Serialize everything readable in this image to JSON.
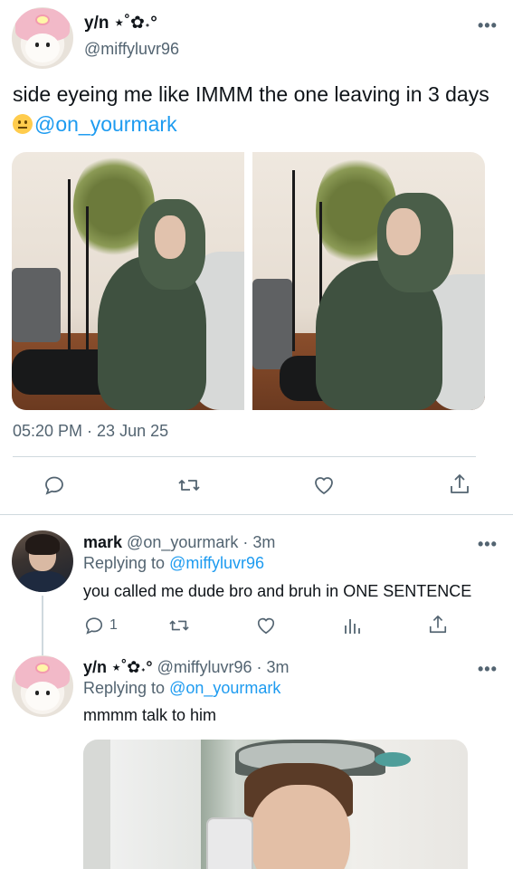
{
  "main_tweet": {
    "display_name": "y/n ⋆˚✿˖°",
    "handle": "@miffyluvr96",
    "more_label": "•••",
    "text": "side eyeing me like IMMM the one leaving in 3 days",
    "emoji": "neutral-face",
    "mention": "@on_yourmark",
    "timestamp": "05:20 PM · 23 Jun 25"
  },
  "actions": {
    "reply": "reply-icon",
    "retweet": "retweet-icon",
    "like": "heart-icon",
    "share": "share-icon"
  },
  "replies": [
    {
      "display_name": "mark",
      "handle_time": "@on_yourmark · 3m",
      "replying_prefix": "Replying to ",
      "replying_to": "@miffyluvr96",
      "text": "you called me dude bro and bruh in ONE SENTENCE",
      "reply_count": "1",
      "more_label": "•••"
    },
    {
      "display_name": "y/n ⋆˚✿˖°",
      "handle_time": "@miffyluvr96 · 3m",
      "replying_prefix": "Replying to ",
      "replying_to": "@on_yourmark",
      "text": "mmmm talk to him",
      "more_label": "•••"
    }
  ]
}
